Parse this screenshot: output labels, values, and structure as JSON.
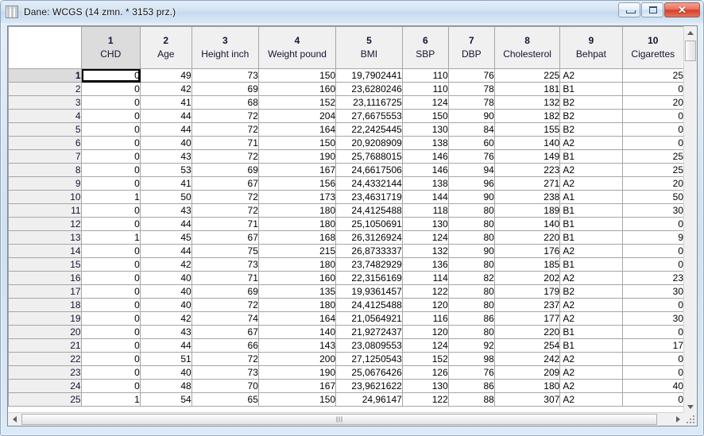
{
  "window": {
    "title": "Dane: WCGS (14 zmn. * 3153 prz.)",
    "icon": "spreadsheet-icon",
    "buttons": {
      "minimize": "minimize-icon",
      "maximize": "maximize-icon",
      "close": "✕"
    }
  },
  "grid": {
    "corner_label": "",
    "columns": [
      {
        "number": "1",
        "name": "CHD",
        "align": "right",
        "selected": true
      },
      {
        "number": "2",
        "name": "Age",
        "align": "right",
        "selected": false
      },
      {
        "number": "3",
        "name": "Height inch",
        "align": "right",
        "selected": false
      },
      {
        "number": "4",
        "name": "Weight pound",
        "align": "right",
        "selected": false
      },
      {
        "number": "5",
        "name": "BMI",
        "align": "right",
        "selected": false
      },
      {
        "number": "6",
        "name": "SBP",
        "align": "right",
        "selected": false
      },
      {
        "number": "7",
        "name": "DBP",
        "align": "right",
        "selected": false
      },
      {
        "number": "8",
        "name": "Cholesterol",
        "align": "right",
        "selected": false
      },
      {
        "number": "9",
        "name": "Behpat",
        "align": "left",
        "selected": false
      },
      {
        "number": "10",
        "name": "Cigarettes",
        "align": "right",
        "selected": false
      }
    ],
    "active_cell": {
      "row": 1,
      "col": 1
    },
    "rows": [
      {
        "n": "1",
        "cells": [
          "0",
          "49",
          "73",
          "150",
          "19,7902441",
          "110",
          "76",
          "225",
          "A2",
          "25"
        ]
      },
      {
        "n": "2",
        "cells": [
          "0",
          "42",
          "69",
          "160",
          "23,6280246",
          "110",
          "78",
          "181",
          "B1",
          "0"
        ]
      },
      {
        "n": "3",
        "cells": [
          "0",
          "41",
          "68",
          "152",
          "23,1116725",
          "124",
          "78",
          "132",
          "B2",
          "20"
        ]
      },
      {
        "n": "4",
        "cells": [
          "0",
          "44",
          "72",
          "204",
          "27,6675553",
          "150",
          "90",
          "182",
          "B2",
          "0"
        ]
      },
      {
        "n": "5",
        "cells": [
          "0",
          "44",
          "72",
          "164",
          "22,2425445",
          "130",
          "84",
          "155",
          "B2",
          "0"
        ]
      },
      {
        "n": "6",
        "cells": [
          "0",
          "40",
          "71",
          "150",
          "20,9208909",
          "138",
          "60",
          "140",
          "A2",
          "0"
        ]
      },
      {
        "n": "7",
        "cells": [
          "0",
          "43",
          "72",
          "190",
          "25,7688015",
          "146",
          "76",
          "149",
          "B1",
          "25"
        ]
      },
      {
        "n": "8",
        "cells": [
          "0",
          "53",
          "69",
          "167",
          "24,6617506",
          "146",
          "94",
          "223",
          "A2",
          "25"
        ]
      },
      {
        "n": "9",
        "cells": [
          "0",
          "41",
          "67",
          "156",
          "24,4332144",
          "138",
          "96",
          "271",
          "A2",
          "20"
        ]
      },
      {
        "n": "10",
        "cells": [
          "1",
          "50",
          "72",
          "173",
          "23,4631719",
          "144",
          "90",
          "238",
          "A1",
          "50"
        ]
      },
      {
        "n": "11",
        "cells": [
          "0",
          "43",
          "72",
          "180",
          "24,4125488",
          "118",
          "80",
          "189",
          "B1",
          "30"
        ]
      },
      {
        "n": "12",
        "cells": [
          "0",
          "44",
          "71",
          "180",
          "25,1050691",
          "130",
          "80",
          "140",
          "B1",
          "0"
        ]
      },
      {
        "n": "13",
        "cells": [
          "1",
          "45",
          "67",
          "168",
          "26,3126924",
          "124",
          "80",
          "220",
          "B1",
          "9"
        ]
      },
      {
        "n": "14",
        "cells": [
          "0",
          "44",
          "75",
          "215",
          "26,8733337",
          "132",
          "90",
          "176",
          "A2",
          "0"
        ]
      },
      {
        "n": "15",
        "cells": [
          "0",
          "42",
          "73",
          "180",
          "23,7482929",
          "136",
          "80",
          "185",
          "B1",
          "0"
        ]
      },
      {
        "n": "16",
        "cells": [
          "0",
          "40",
          "71",
          "160",
          "22,3156169",
          "114",
          "82",
          "202",
          "A2",
          "23"
        ]
      },
      {
        "n": "17",
        "cells": [
          "0",
          "40",
          "69",
          "135",
          "19,9361457",
          "122",
          "80",
          "179",
          "B2",
          "30"
        ]
      },
      {
        "n": "18",
        "cells": [
          "0",
          "40",
          "72",
          "180",
          "24,4125488",
          "120",
          "80",
          "237",
          "A2",
          "0"
        ]
      },
      {
        "n": "19",
        "cells": [
          "0",
          "42",
          "74",
          "164",
          "21,0564921",
          "116",
          "86",
          "177",
          "A2",
          "30"
        ]
      },
      {
        "n": "20",
        "cells": [
          "0",
          "43",
          "67",
          "140",
          "21,9272437",
          "120",
          "80",
          "220",
          "B1",
          "0"
        ]
      },
      {
        "n": "21",
        "cells": [
          "0",
          "44",
          "66",
          "143",
          "23,0809553",
          "124",
          "92",
          "254",
          "B1",
          "17"
        ]
      },
      {
        "n": "22",
        "cells": [
          "0",
          "51",
          "72",
          "200",
          "27,1250543",
          "152",
          "98",
          "242",
          "A2",
          "0"
        ]
      },
      {
        "n": "23",
        "cells": [
          "0",
          "40",
          "73",
          "190",
          "25,0676426",
          "126",
          "76",
          "209",
          "A2",
          "0"
        ]
      },
      {
        "n": "24",
        "cells": [
          "0",
          "48",
          "70",
          "167",
          "23,9621622",
          "130",
          "86",
          "180",
          "A2",
          "40"
        ]
      },
      {
        "n": "25",
        "cells": [
          "1",
          "54",
          "65",
          "150",
          "24,96147",
          "122",
          "88",
          "307",
          "A2",
          "0"
        ]
      }
    ]
  },
  "scrollbars": {
    "vertical": {
      "up": "scroll-up-arrow",
      "down": "scroll-down-arrow"
    },
    "horizontal": {
      "left": "scroll-left-arrow",
      "right": "scroll-right-arrow"
    }
  },
  "colors": {
    "header_bg": "#f0f0f0",
    "header_selected_bg": "#dcdcdc",
    "rowhead_bg": "#efefef",
    "grid_line": "#c8c8c8",
    "title_gradient_top": "#e4eef8",
    "close_button": "#d4402b"
  }
}
